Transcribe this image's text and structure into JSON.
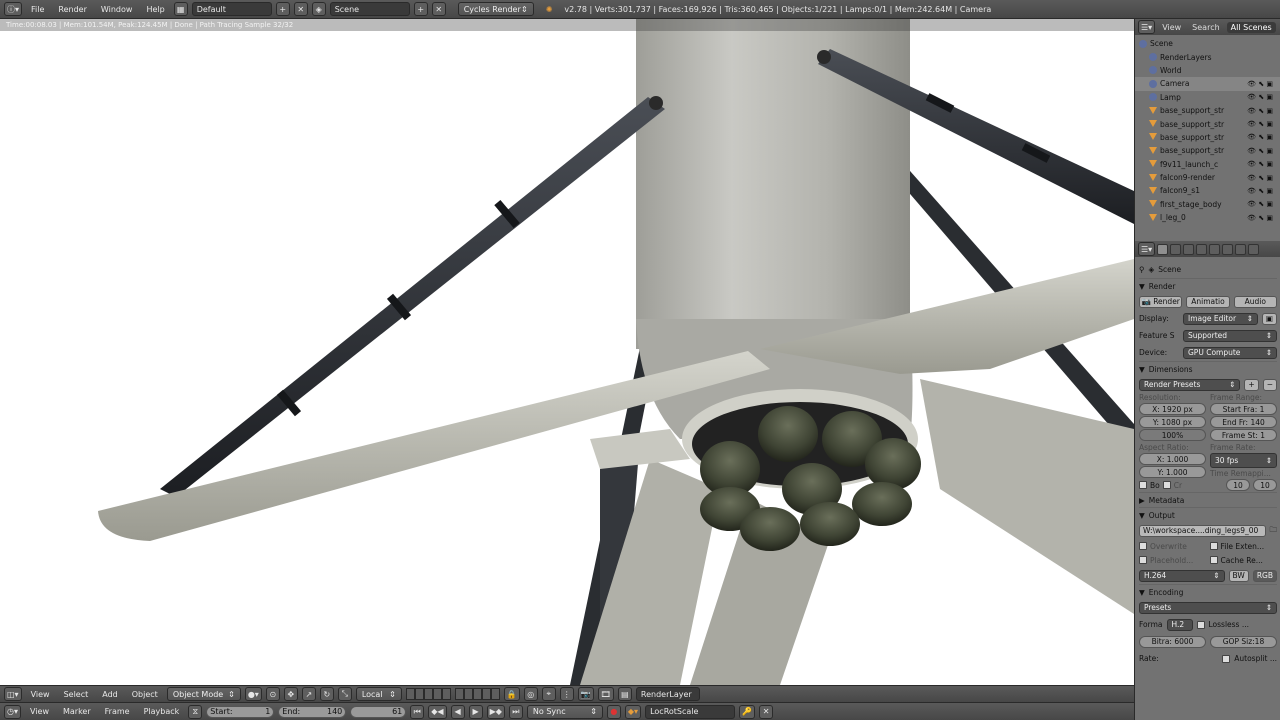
{
  "topbar": {
    "menus": [
      "File",
      "Render",
      "Window",
      "Help"
    ],
    "screen_layout": "Default",
    "scene": "Scene",
    "engine": "Cycles Render",
    "stats": "v2.78 | Verts:301,737 | Faces:169,926 | Tris:360,465 | Objects:1/221 | Lamps:0/1 | Mem:242.64M | Camera"
  },
  "render_info": "Time:00:08.03 | Mem:101.54M, Peak:124.45M | Done | Path Tracing Sample 32/32",
  "outliner": {
    "tabs": [
      "View",
      "Search",
      "All Scenes"
    ],
    "items": [
      {
        "label": "Scene",
        "indent": 0
      },
      {
        "label": "RenderLayers",
        "indent": 1
      },
      {
        "label": "World",
        "indent": 1
      },
      {
        "label": "Camera",
        "indent": 1,
        "selected": true
      },
      {
        "label": "Lamp",
        "indent": 1
      },
      {
        "label": "base_support_str",
        "indent": 1
      },
      {
        "label": "base_support_str",
        "indent": 1
      },
      {
        "label": "base_support_str",
        "indent": 1
      },
      {
        "label": "base_support_str",
        "indent": 1
      },
      {
        "label": "f9v11_launch_c",
        "indent": 1
      },
      {
        "label": "falcon9-render",
        "indent": 1
      },
      {
        "label": "falcon9_s1",
        "indent": 1
      },
      {
        "label": "first_stage_body",
        "indent": 1
      },
      {
        "label": "l_leg_0",
        "indent": 1
      }
    ]
  },
  "properties": {
    "context": "Scene",
    "render": {
      "title": "Render",
      "buttons": [
        "Render",
        "Animatio",
        "Audio"
      ],
      "display_label": "Display:",
      "display_value": "Image Editor",
      "feature_label": "Feature S",
      "feature_value": "Supported",
      "device_label": "Device:",
      "device_value": "GPU Compute"
    },
    "dimensions": {
      "title": "Dimensions",
      "presets": "Render Presets",
      "resolution_label": "Resolution:",
      "res_x": "X: 1920 px",
      "res_y": "Y: 1080 px",
      "res_pct": "100%",
      "frame_range_label": "Frame Range:",
      "start_frame": "Start Fra: 1",
      "end_frame": "End Fr: 140",
      "frame_step": "Frame St: 1",
      "aspect_label": "Aspect Ratio:",
      "aspect_x": "X:     1.000",
      "aspect_y": "Y:     1.000",
      "frame_rate_label": "Frame Rate:",
      "frame_rate": "30 fps",
      "time_remap_label": "Time Remappi...",
      "remap_old": "10",
      "remap_new": "10",
      "border_label": "Bo",
      "crop_label": "Cr"
    },
    "metadata": {
      "title": "Metadata"
    },
    "output": {
      "title": "Output",
      "path": "W:\\workspace....ding_legs9_00",
      "overwrite": "Overwrite",
      "file_ext": "File Exten...",
      "placeholders": "Placehold...",
      "cache": "Cache Re...",
      "format": "H.264",
      "bw": "BW",
      "rgb": "RGB"
    },
    "encoding": {
      "title": "Encoding",
      "presets": "Presets",
      "format_label": "Forma",
      "format_value": "H.2",
      "lossless": "Lossless ...",
      "bitrate": "Bitra: 6000",
      "gop": "GOP Siz:18",
      "rate_label": "Rate:",
      "autosplit": "Autosplit ..."
    }
  },
  "bottombar1": {
    "menus": [
      "View",
      "Select",
      "Add",
      "Object"
    ],
    "mode": "Object Mode",
    "orientation": "Local",
    "render_layer": "RenderLayer"
  },
  "bottombar2": {
    "menus": [
      "View",
      "Marker",
      "Frame",
      "Playback"
    ],
    "start": "Start:",
    "start_value": "1",
    "end": "End:",
    "end_value": "140",
    "current": "61",
    "sync": "No Sync",
    "keying_set": "LocRotScale"
  },
  "colors": {
    "panel_bg": "#727272",
    "header_bg": "#4d4d4d",
    "viewport_bg": "#ffffff",
    "rocket_body": "#b7b7b2",
    "legs": "#c0c0b8",
    "struts": "#2b2e33",
    "keyframe_accent": "#e59c3b"
  }
}
